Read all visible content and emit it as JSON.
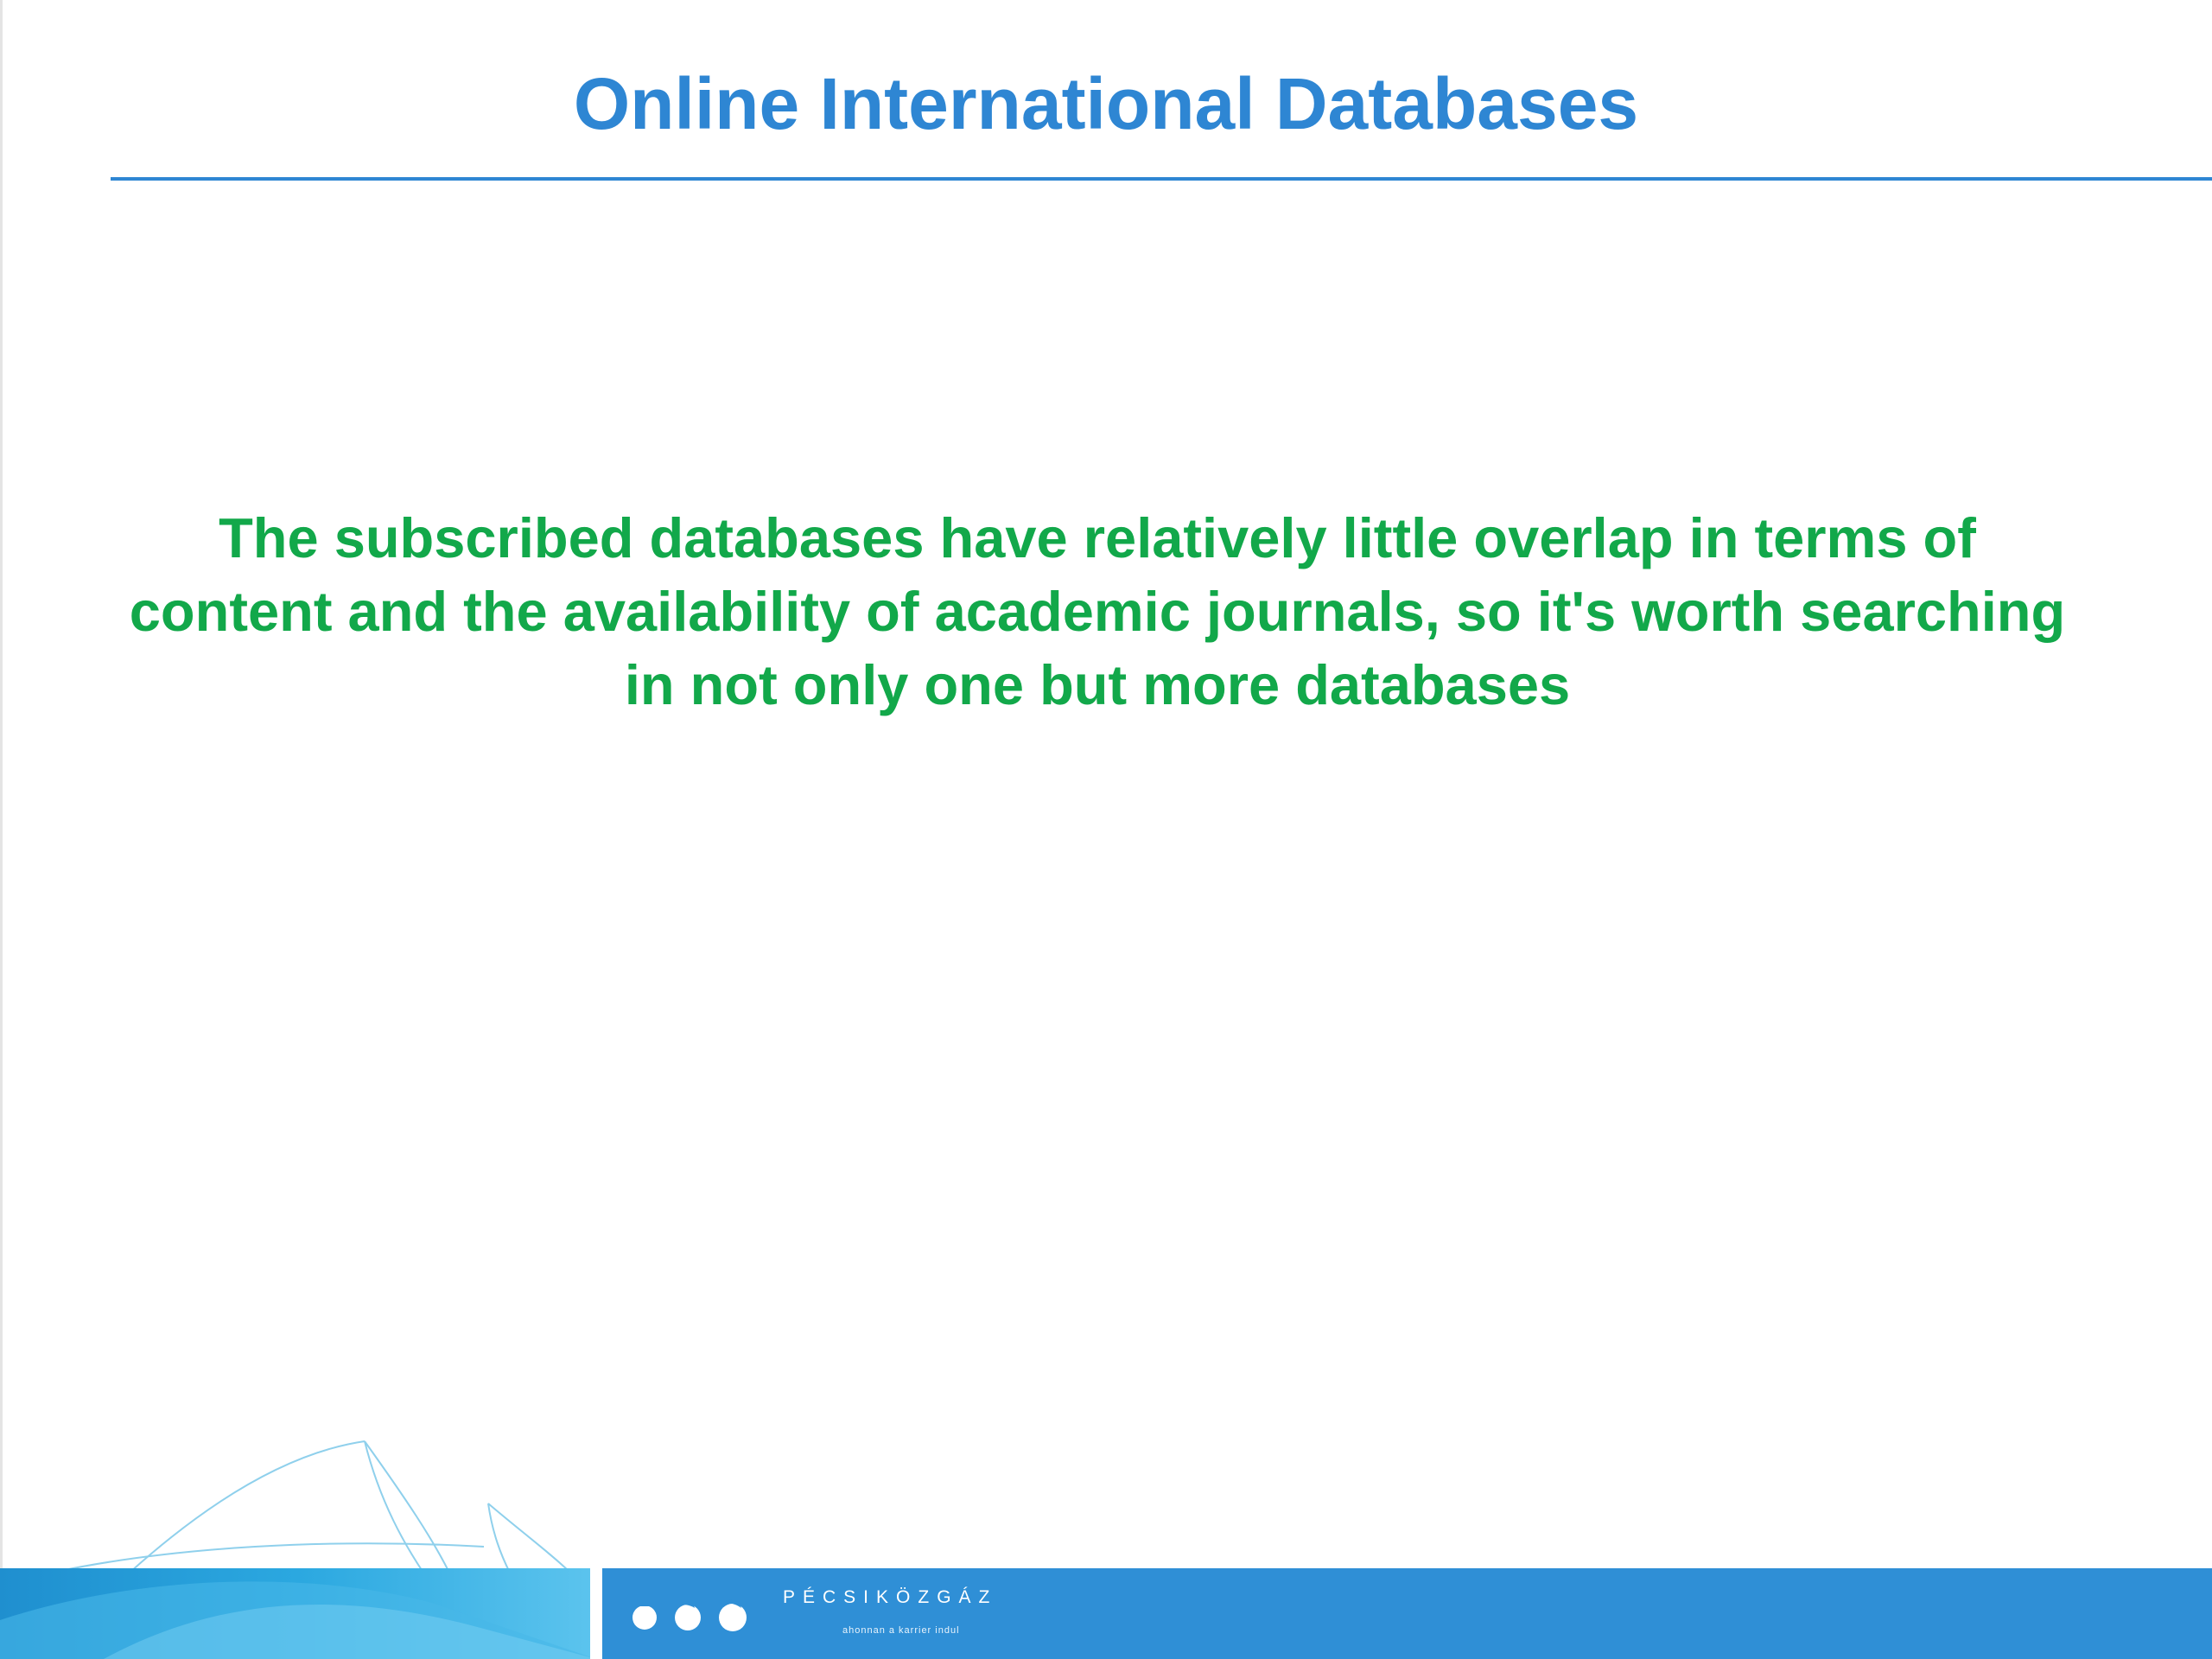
{
  "slide": {
    "title": "Online International Databases",
    "body": "The subscribed databases have relatively little overlap in terms of content and the availability of academic journals, so it's worth searching in not only one but more databases"
  },
  "footer": {
    "logo_name": "PÉCSIKÖZGÁZ",
    "logo_tagline": "ahonnan a karrier indul"
  },
  "colors": {
    "title": "#2e86d3",
    "body": "#12a84a",
    "footer_bar": "#2f8fd6"
  }
}
